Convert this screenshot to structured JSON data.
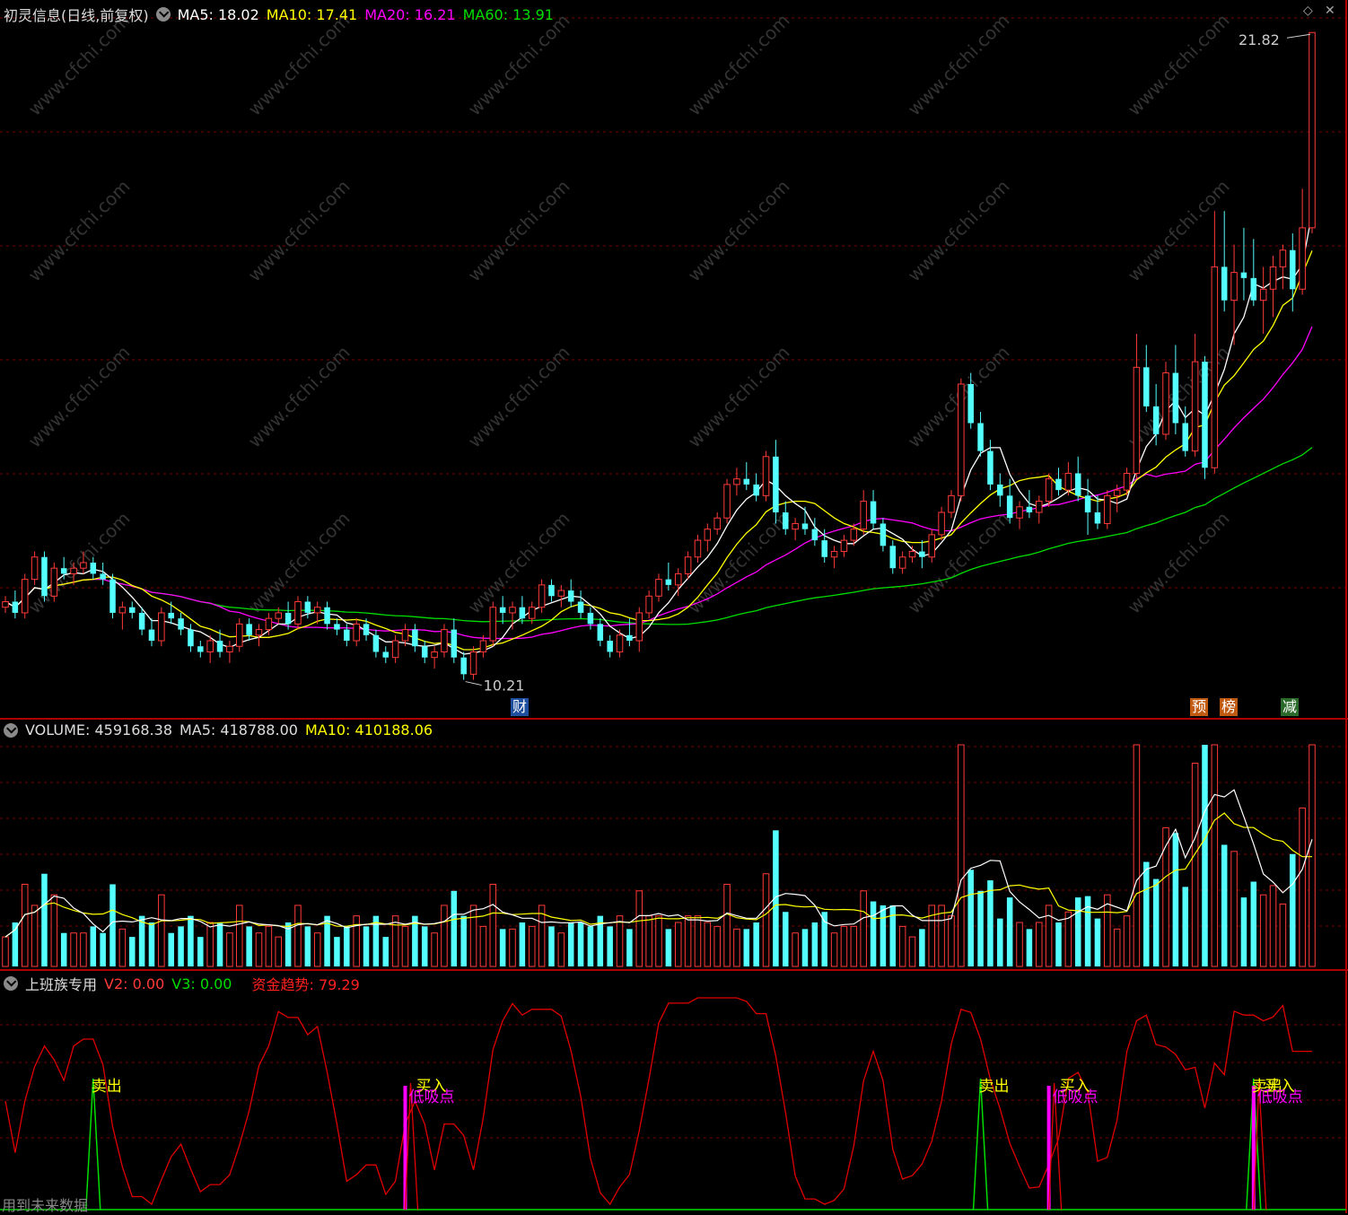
{
  "main_header": {
    "title": "初灵信息(日线,前复权)",
    "ma5": "MA5: 18.02",
    "ma10": "MA10: 17.41",
    "ma20": "MA20: 16.21",
    "ma60": "MA60: 13.91"
  },
  "volume_header": {
    "label": "VOLUME: 459168.38",
    "ma5": "MA5: 418788.00",
    "ma10": "MA10: 410188.06"
  },
  "indicator_header": {
    "name": "上班族专用",
    "v2": "V2: 0.00",
    "v3": "V3: 0.00",
    "trend": "资金趋势: 79.29"
  },
  "markers": {
    "high_label": "21.82",
    "low_label": "10.21",
    "cai": "财",
    "yu": "预",
    "bang": "榜",
    "jian": "减"
  },
  "signals": {
    "sell": "卖出",
    "buy": "买入",
    "dip": "低吸点"
  },
  "footer_note": "用到未来数据",
  "watermark": "www.cfchi.com",
  "colors": {
    "up": "#ff3a3a",
    "down": "#54ffff",
    "ma5": "#ffffff",
    "ma10": "#ffff00",
    "ma20": "#ff00ff",
    "ma60": "#00dd00",
    "trend": "#e00000",
    "signal_green": "#00dd00",
    "signal_magenta": "#ff00ff",
    "grid": "#7a0000"
  },
  "chart_data": [
    {
      "type": "candlestick",
      "title": "初灵信息(日线,前复权)",
      "ylim": [
        9.3,
        22.5
      ],
      "annotations": {
        "high": 21.82,
        "low": 10.21
      },
      "series_ma": [
        {
          "name": "MA5",
          "last": 18.02
        },
        {
          "name": "MA10",
          "last": 17.41
        },
        {
          "name": "MA20",
          "last": 16.21
        },
        {
          "name": "MA60",
          "last": 13.91
        }
      ],
      "ohlc": [
        [
          11.5,
          11.7,
          11.4,
          11.6
        ],
        [
          11.6,
          11.8,
          11.3,
          11.4
        ],
        [
          11.4,
          12.1,
          11.3,
          12.0
        ],
        [
          12.0,
          12.5,
          11.9,
          12.4
        ],
        [
          12.4,
          12.5,
          11.6,
          11.7
        ],
        [
          11.7,
          12.3,
          11.6,
          12.2
        ],
        [
          12.2,
          12.4,
          12.0,
          12.1
        ],
        [
          12.1,
          12.3,
          11.9,
          12.2
        ],
        [
          12.2,
          12.5,
          12.1,
          12.3
        ],
        [
          12.3,
          12.4,
          12.0,
          12.1
        ],
        [
          12.1,
          12.3,
          11.9,
          12.0
        ],
        [
          12.0,
          12.1,
          11.3,
          11.4
        ],
        [
          11.4,
          11.6,
          11.1,
          11.5
        ],
        [
          11.5,
          11.6,
          11.3,
          11.4
        ],
        [
          11.4,
          11.5,
          11.0,
          11.1
        ],
        [
          11.1,
          11.3,
          10.8,
          10.9
        ],
        [
          10.9,
          11.5,
          10.8,
          11.4
        ],
        [
          11.4,
          11.6,
          11.2,
          11.3
        ],
        [
          11.3,
          11.4,
          11.0,
          11.1
        ],
        [
          11.1,
          11.2,
          10.7,
          10.8
        ],
        [
          10.8,
          10.9,
          10.6,
          10.7
        ],
        [
          10.7,
          11.0,
          10.5,
          10.9
        ],
        [
          10.9,
          11.1,
          10.6,
          10.7
        ],
        [
          10.7,
          10.9,
          10.5,
          10.8
        ],
        [
          10.8,
          11.3,
          10.7,
          11.2
        ],
        [
          11.2,
          11.3,
          10.9,
          11.0
        ],
        [
          11.0,
          11.2,
          10.8,
          11.1
        ],
        [
          11.1,
          11.4,
          11.0,
          11.3
        ],
        [
          11.3,
          11.5,
          11.2,
          11.4
        ],
        [
          11.4,
          11.6,
          11.1,
          11.2
        ],
        [
          11.2,
          11.7,
          11.1,
          11.6
        ],
        [
          11.6,
          11.7,
          11.3,
          11.4
        ],
        [
          11.4,
          11.6,
          11.2,
          11.5
        ],
        [
          11.5,
          11.6,
          11.1,
          11.2
        ],
        [
          11.2,
          11.3,
          11.0,
          11.1
        ],
        [
          11.1,
          11.2,
          10.8,
          10.9
        ],
        [
          10.9,
          11.3,
          10.8,
          11.2
        ],
        [
          11.2,
          11.3,
          10.9,
          11.0
        ],
        [
          11.0,
          11.1,
          10.6,
          10.7
        ],
        [
          10.7,
          10.8,
          10.5,
          10.6
        ],
        [
          10.6,
          11.0,
          10.5,
          10.9
        ],
        [
          10.9,
          11.2,
          10.8,
          11.1
        ],
        [
          11.1,
          11.2,
          10.7,
          10.8
        ],
        [
          10.8,
          10.9,
          10.5,
          10.6
        ],
        [
          10.6,
          10.8,
          10.4,
          10.7
        ],
        [
          10.7,
          11.2,
          10.6,
          11.1
        ],
        [
          11.1,
          11.3,
          10.5,
          10.6
        ],
        [
          10.6,
          10.7,
          10.2,
          10.3
        ],
        [
          10.3,
          10.8,
          10.2,
          10.7
        ],
        [
          10.7,
          11.0,
          10.6,
          10.9
        ],
        [
          10.9,
          11.6,
          10.8,
          11.5
        ],
        [
          11.5,
          11.7,
          11.2,
          11.4
        ],
        [
          11.4,
          11.6,
          11.1,
          11.5
        ],
        [
          11.5,
          11.7,
          11.2,
          11.3
        ],
        [
          11.3,
          11.6,
          11.2,
          11.5
        ],
        [
          11.5,
          12.0,
          11.4,
          11.9
        ],
        [
          11.9,
          12.0,
          11.6,
          11.7
        ],
        [
          11.7,
          11.9,
          11.5,
          11.8
        ],
        [
          11.8,
          12.0,
          11.5,
          11.6
        ],
        [
          11.6,
          11.8,
          11.3,
          11.4
        ],
        [
          11.4,
          11.5,
          11.1,
          11.2
        ],
        [
          11.2,
          11.3,
          10.8,
          10.9
        ],
        [
          10.9,
          11.0,
          10.6,
          10.7
        ],
        [
          10.7,
          11.1,
          10.6,
          11.0
        ],
        [
          11.0,
          11.3,
          10.8,
          10.9
        ],
        [
          10.9,
          11.5,
          10.7,
          11.4
        ],
        [
          11.4,
          11.8,
          11.3,
          11.7
        ],
        [
          11.7,
          12.1,
          11.6,
          12.0
        ],
        [
          12.0,
          12.3,
          11.8,
          11.9
        ],
        [
          11.9,
          12.2,
          11.7,
          12.1
        ],
        [
          12.1,
          12.5,
          12.0,
          12.4
        ],
        [
          12.4,
          12.8,
          12.3,
          12.7
        ],
        [
          12.7,
          13.0,
          12.5,
          12.9
        ],
        [
          12.9,
          13.2,
          12.8,
          13.1
        ],
        [
          13.1,
          13.8,
          13.0,
          13.7
        ],
        [
          13.7,
          14.0,
          13.5,
          13.8
        ],
        [
          13.8,
          14.1,
          13.6,
          13.7
        ],
        [
          13.7,
          13.9,
          13.4,
          13.5
        ],
        [
          13.5,
          14.3,
          13.4,
          14.2
        ],
        [
          14.2,
          14.5,
          13.0,
          13.2
        ],
        [
          13.2,
          13.4,
          12.8,
          12.9
        ],
        [
          12.9,
          13.1,
          12.7,
          13.0
        ],
        [
          13.0,
          13.3,
          12.8,
          12.9
        ],
        [
          12.9,
          13.1,
          12.6,
          12.7
        ],
        [
          12.7,
          12.9,
          12.3,
          12.4
        ],
        [
          12.4,
          12.6,
          12.2,
          12.5
        ],
        [
          12.5,
          12.8,
          12.4,
          12.7
        ],
        [
          12.7,
          13.0,
          12.6,
          12.9
        ],
        [
          12.9,
          13.6,
          12.8,
          13.4
        ],
        [
          13.4,
          13.6,
          12.9,
          13.0
        ],
        [
          13.0,
          13.1,
          12.5,
          12.6
        ],
        [
          12.6,
          12.7,
          12.1,
          12.2
        ],
        [
          12.2,
          12.5,
          12.1,
          12.4
        ],
        [
          12.4,
          12.6,
          12.3,
          12.5
        ],
        [
          12.5,
          12.7,
          12.2,
          12.4
        ],
        [
          12.4,
          12.9,
          12.3,
          12.8
        ],
        [
          12.8,
          13.3,
          12.7,
          13.2
        ],
        [
          13.2,
          13.6,
          13.1,
          13.5
        ],
        [
          13.5,
          15.6,
          13.4,
          15.5
        ],
        [
          15.5,
          15.7,
          14.7,
          14.8
        ],
        [
          14.8,
          15.0,
          14.2,
          14.3
        ],
        [
          14.3,
          14.5,
          13.6,
          13.7
        ],
        [
          13.7,
          13.9,
          13.3,
          13.5
        ],
        [
          13.5,
          13.8,
          13.0,
          13.1
        ],
        [
          13.1,
          13.4,
          12.9,
          13.3
        ],
        [
          13.3,
          13.6,
          13.1,
          13.2
        ],
        [
          13.2,
          13.5,
          13.0,
          13.4
        ],
        [
          13.4,
          13.9,
          13.3,
          13.8
        ],
        [
          13.8,
          14.0,
          13.5,
          13.6
        ],
        [
          13.6,
          14.1,
          13.5,
          13.9
        ],
        [
          13.9,
          14.2,
          13.4,
          13.5
        ],
        [
          13.5,
          13.8,
          12.8,
          13.2
        ],
        [
          13.2,
          13.5,
          12.9,
          13.0
        ],
        [
          13.0,
          13.6,
          12.9,
          13.5
        ],
        [
          13.5,
          13.7,
          13.2,
          13.6
        ],
        [
          13.6,
          14.0,
          13.5,
          13.9
        ],
        [
          13.9,
          16.4,
          13.8,
          15.8
        ],
        [
          15.8,
          16.2,
          15.0,
          15.1
        ],
        [
          15.1,
          15.5,
          14.4,
          14.6
        ],
        [
          14.6,
          15.9,
          14.5,
          15.7
        ],
        [
          15.7,
          16.2,
          14.6,
          14.8
        ],
        [
          14.8,
          15.1,
          14.2,
          14.3
        ],
        [
          14.3,
          16.4,
          14.2,
          15.9
        ],
        [
          15.9,
          16.0,
          13.8,
          14.0
        ],
        [
          14.0,
          18.6,
          13.9,
          17.6
        ],
        [
          17.6,
          18.6,
          16.8,
          17.0
        ],
        [
          17.0,
          18.0,
          16.2,
          17.5
        ],
        [
          17.5,
          18.3,
          17.0,
          17.4
        ],
        [
          17.4,
          18.1,
          16.9,
          17.0
        ],
        [
          17.0,
          17.6,
          16.4,
          17.2
        ],
        [
          17.2,
          17.8,
          16.7,
          17.6
        ],
        [
          17.6,
          18.0,
          17.2,
          17.9
        ],
        [
          17.9,
          18.2,
          16.8,
          17.2
        ],
        [
          17.2,
          19.0,
          17.1,
          18.3
        ],
        [
          18.3,
          21.8,
          18.2,
          21.8
        ]
      ]
    },
    {
      "type": "bar",
      "title": "VOLUME",
      "values_summary": {
        "last": 459168.38,
        "ma5": 418788.0,
        "ma10": 410188.06
      }
    },
    {
      "type": "line",
      "title": "上班族专用",
      "series": [
        {
          "name": "资金趋势",
          "last": 79.29
        },
        {
          "name": "V2",
          "last": 0.0
        },
        {
          "name": "V3",
          "last": 0.0
        }
      ]
    }
  ]
}
